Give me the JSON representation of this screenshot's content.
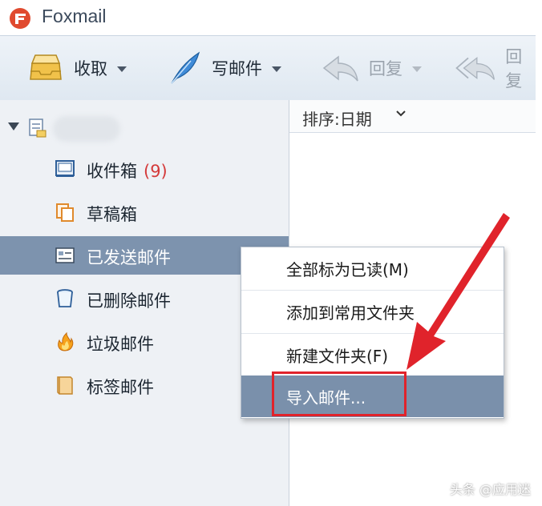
{
  "app": {
    "title": "Foxmail"
  },
  "toolbar": {
    "receive_label": "收取",
    "compose_label": "写邮件",
    "reply_label": "回复",
    "reply_all_label": "回复"
  },
  "sidebar": {
    "folders": [
      {
        "label": "收件箱",
        "count": "(9)"
      },
      {
        "label": "草稿箱"
      },
      {
        "label": "已发送邮件",
        "selected": true
      },
      {
        "label": "已删除邮件"
      },
      {
        "label": "垃圾邮件"
      },
      {
        "label": "标签邮件"
      }
    ]
  },
  "list": {
    "sort_label": "排序:日期"
  },
  "context_menu": {
    "items": [
      {
        "label": "全部标为已读(M)"
      },
      {
        "label": "添加到常用文件夹"
      },
      {
        "label": "新建文件夹(F)"
      },
      {
        "label": "导入邮件...",
        "highlighted": true
      }
    ]
  },
  "watermark": "头条 @应用迷",
  "colors": {
    "accent": "#7d93ae",
    "annotation": "#e0232b",
    "badge": "#d43a3a"
  }
}
